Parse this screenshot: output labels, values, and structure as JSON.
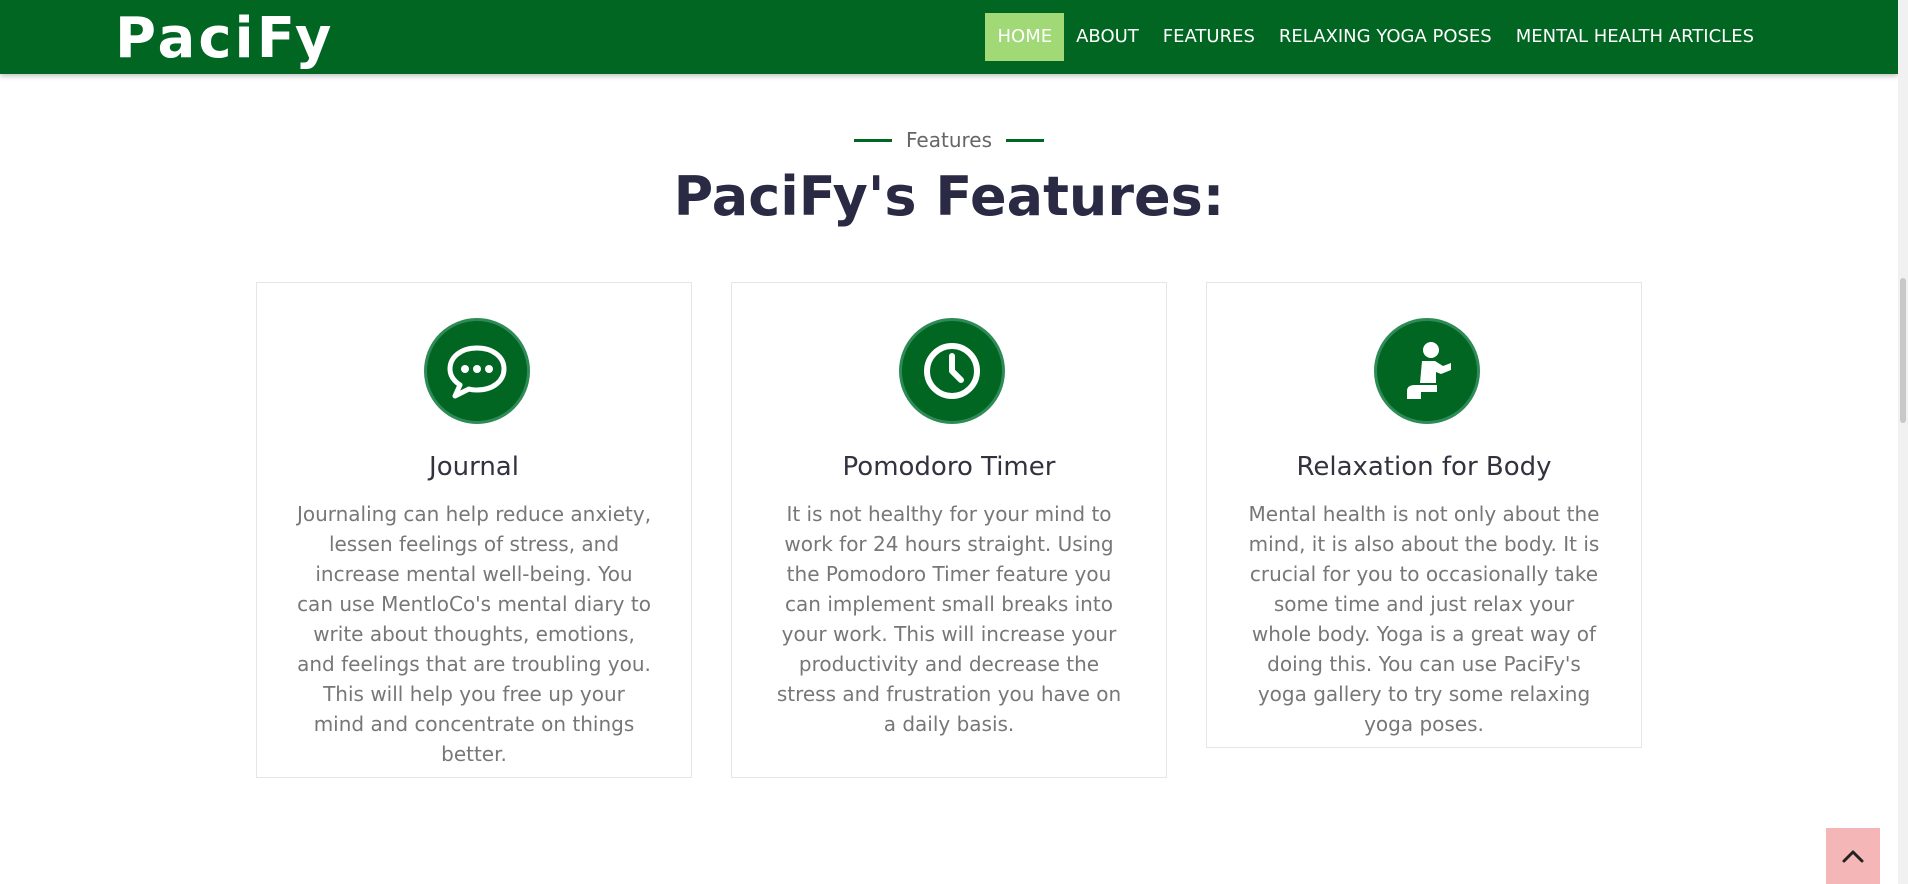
{
  "header": {
    "brand": "PaciFy",
    "nav": [
      {
        "label": "HOME",
        "active": true
      },
      {
        "label": "ABOUT",
        "active": false
      },
      {
        "label": "FEATURES",
        "active": false
      },
      {
        "label": "RELAXING YOGA POSES",
        "active": false
      },
      {
        "label": "MENTAL HEALTH ARTICLES",
        "active": false
      }
    ]
  },
  "section": {
    "tag": "Features",
    "title": "PaciFy's Features:"
  },
  "cards": [
    {
      "icon": "chat-bubble-icon",
      "title": "Journal",
      "text": "Journaling can help reduce anxiety, lessen feelings of stress, and increase mental well-being. You can use MentloCo's mental diary to write about thoughts, emotions, and feelings that are troubling you. This will help you free up your mind and concentrate on things better."
    },
    {
      "icon": "clock-icon",
      "title": "Pomodoro Timer",
      "text": "It is not healthy for your mind to work for 24 hours straight. Using the Pomodoro Timer feature you can implement small breaks into your work. This will increase your productivity and decrease the stress and frustration you have on a daily basis."
    },
    {
      "icon": "kneeling-person-icon",
      "title": "Relaxation for Body",
      "text": "Mental health is not only about the mind, it is also about the body. It is crucial for you to occasionally take some time and just relax your whole body. Yoga is a great way of doing this. You can use PaciFy's yoga gallery to try some relaxing yoga poses."
    }
  ],
  "back_to_top": {
    "icon": "chevron-up-icon"
  },
  "colors": {
    "primary": "#006622",
    "nav_active": "#a2d977",
    "title": "#2a2a45",
    "body_text": "#777777",
    "back_to_top": "#f4b6b6"
  }
}
